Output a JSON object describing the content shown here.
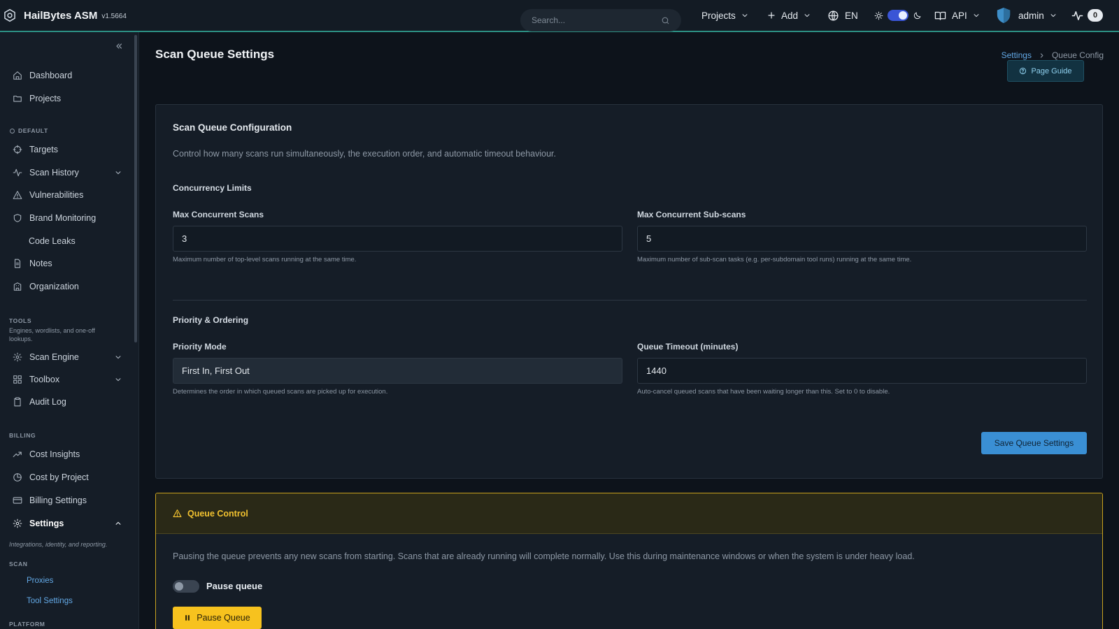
{
  "app": {
    "name": "HailBytes ASM",
    "version": "v1.5664"
  },
  "topbar": {
    "search_placeholder": "Search...",
    "projects_label": "Projects",
    "add_label": "Add",
    "language": "EN",
    "api_label": "API",
    "user": "admin",
    "notifications_count": "0"
  },
  "sidebar": {
    "top_items": [
      {
        "label": "Dashboard",
        "icon": "home-icon"
      },
      {
        "label": "Projects",
        "icon": "folder-icon"
      }
    ],
    "default_section": "DEFAULT",
    "default_items": [
      {
        "label": "Targets",
        "icon": "crosshair-icon"
      },
      {
        "label": "Scan History",
        "icon": "activity-icon"
      },
      {
        "label": "Vulnerabilities",
        "icon": "warning-icon"
      },
      {
        "label": "Brand Monitoring",
        "icon": "shield-icon"
      },
      {
        "label": "Code Leaks",
        "icon": ""
      },
      {
        "label": "Notes",
        "icon": "file-icon"
      },
      {
        "label": "Organization",
        "icon": "building-icon"
      }
    ],
    "tools_section": "TOOLS",
    "tools_desc": "Engines, wordlists, and one-off lookups.",
    "tools_items": [
      {
        "label": "Scan Engine",
        "icon": "gear-icon"
      },
      {
        "label": "Toolbox",
        "icon": "grid-icon"
      },
      {
        "label": "Audit Log",
        "icon": "clipboard-icon"
      }
    ],
    "billing_section": "BILLING",
    "billing_items": [
      {
        "label": "Cost Insights",
        "icon": "trend-icon"
      },
      {
        "label": "Cost by Project",
        "icon": "pie-icon"
      },
      {
        "label": "Billing Settings",
        "icon": "card-icon"
      }
    ],
    "settings_label": "Settings",
    "settings_desc": "Integrations, identity, and reporting.",
    "scan_section": "SCAN",
    "scan_subitems": [
      "Proxies",
      "Tool Settings"
    ],
    "platform_section": "PLATFORM"
  },
  "page": {
    "title": "Scan Queue Settings",
    "breadcrumb": [
      "Settings",
      "Queue Config"
    ],
    "guide_button": "Page Guide"
  },
  "config": {
    "title": "Scan Queue Configuration",
    "description": "Control how many scans run simultaneously, the execution order, and automatic timeout behaviour.",
    "concurrency_heading": "Concurrency Limits",
    "max_scans_label": "Max Concurrent Scans",
    "max_scans_value": "3",
    "max_scans_help": "Maximum number of top-level scans running at the same time.",
    "max_subscans_label": "Max Concurrent Sub-scans",
    "max_subscans_value": "5",
    "max_subscans_help": "Maximum number of sub-scan tasks (e.g. per-subdomain tool runs) running at the same time.",
    "priority_heading": "Priority & Ordering",
    "priority_label": "Priority Mode",
    "priority_value": "First In, First Out",
    "priority_help": "Determines the order in which queued scans are picked up for execution.",
    "timeout_label": "Queue Timeout (minutes)",
    "timeout_value": "1440",
    "timeout_help": "Auto-cancel queued scans that have been waiting longer than this. Set to 0 to disable.",
    "save_button": "Save Queue Settings"
  },
  "queue_control": {
    "title": "Queue Control",
    "description": "Pausing the queue prevents any new scans from starting. Scans that are already running will complete normally. Use this during maintenance windows or when the system is under heavy load.",
    "toggle_label": "Pause queue",
    "toggle_on": false,
    "pause_button": "Pause Queue"
  },
  "colors": {
    "accent": "#3a8fd4",
    "warning": "#f7c21e",
    "topbar_border": "#2c8f83"
  }
}
